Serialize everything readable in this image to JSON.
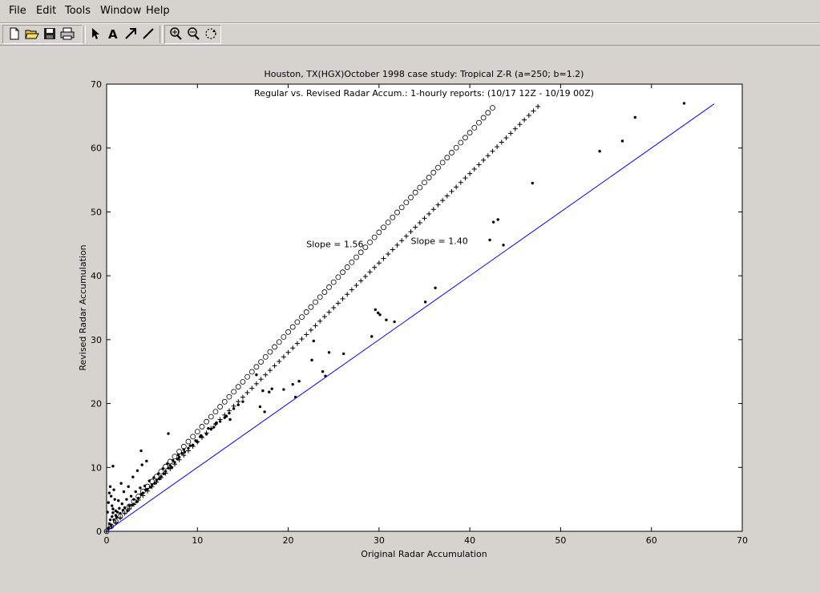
{
  "menu": {
    "file": "File",
    "edit": "Edit",
    "tools": "Tools",
    "window": "Window",
    "help": "Help"
  },
  "toolbar": {
    "icons": [
      "new-file-icon",
      "open-folder-icon",
      "save-icon",
      "print-icon",
      "arrow-select-icon",
      "text-icon",
      "draw-arrow-icon",
      "draw-line-icon",
      "zoom-in-icon",
      "zoom-out-icon",
      "rotate-icon"
    ]
  },
  "chart_data": {
    "type": "scatter",
    "title": "Houston, TX(HGX)October 1998 case study: Tropical Z-R (a=250; b=1.2)",
    "subtitle": "Regular vs. Revised Radar Accum.: 1-hourly reports: (10/17 12Z - 10/19 00Z)",
    "xlabel": "Original Radar Accumulation",
    "ylabel": "Revised Radar Accumulation",
    "xlim": [
      0,
      70
    ],
    "ylim": [
      0,
      70
    ],
    "xticks": [
      0,
      10,
      20,
      30,
      40,
      50,
      60,
      70
    ],
    "yticks": [
      0,
      10,
      20,
      30,
      40,
      50,
      60,
      70
    ],
    "grid": false,
    "annotations": [
      {
        "text": "Slope = 1.56",
        "x": 22.0,
        "y": 44.5
      },
      {
        "text": "Slope = 1.40",
        "x": 33.5,
        "y": 45.0
      }
    ],
    "series": [
      {
        "marker": "dot",
        "x": [
          0.2,
          0.3,
          0.5,
          0.6,
          0.8,
          1.0,
          1.2,
          1.5,
          1.8,
          2.0,
          2.3,
          2.5,
          2.8,
          3.0,
          3.3,
          3.5,
          3.8,
          4.0,
          4.3,
          4.5,
          4.8,
          5.0,
          5.3,
          5.5,
          5.8,
          6.0,
          6.3,
          6.5,
          6.8,
          7.0,
          7.2,
          7.5,
          7.8,
          8.0,
          8.3,
          8.6,
          9.0,
          9.5,
          10.0,
          10.5,
          11.0,
          11.5,
          12.0,
          12.5,
          13.0,
          13.5,
          14.0,
          14.5,
          15.0,
          0.4,
          0.7,
          1.1,
          1.4,
          1.7,
          2.2,
          2.7,
          3.2,
          3.7,
          4.2,
          4.7,
          5.2,
          5.7,
          6.2,
          6.7,
          7.3,
          7.9,
          8.5,
          9.2,
          9.8,
          10.4,
          11.2,
          12.1,
          13.2,
          0.1,
          0.2,
          0.3,
          0.4,
          0.5,
          0.6,
          0.7,
          0.8,
          0.9,
          1.0,
          1.3,
          1.6,
          1.9,
          2.4,
          2.9,
          3.4,
          3.9,
          4.4,
          0.7,
          3.8,
          6.8,
          10.3,
          11.8,
          13.6,
          16.9,
          17.4,
          18.2,
          17.9,
          16.5,
          17.2,
          19.5,
          20.5,
          20.8,
          21.2,
          22.8,
          22.6,
          24.1,
          24.5,
          23.8,
          26.1,
          29.2,
          29.6,
          29.9,
          30.1,
          30.8,
          31.7,
          35.1,
          36.2,
          42.2,
          42.6,
          43.1,
          43.7,
          46.9,
          54.3,
          56.8,
          58.2,
          63.6
        ],
        "y": [
          0.5,
          1.2,
          1.0,
          2.3,
          1.8,
          2.5,
          3.0,
          2.8,
          3.3,
          3.7,
          3.2,
          4.0,
          4.1,
          5.0,
          4.6,
          5.2,
          5.8,
          6.0,
          6.5,
          6.6,
          6.9,
          7.3,
          7.5,
          8.0,
          8.2,
          8.6,
          9.0,
          9.4,
          9.9,
          10.3,
          10.0,
          10.8,
          11.3,
          11.6,
          12.2,
          12.4,
          13.0,
          13.5,
          14.0,
          14.8,
          15.2,
          16.0,
          16.8,
          17.2,
          17.8,
          18.5,
          19.2,
          19.8,
          20.3,
          1.8,
          2.9,
          2.2,
          3.6,
          4.3,
          5.0,
          5.5,
          6.2,
          6.8,
          7.1,
          7.9,
          8.4,
          9.0,
          9.8,
          10.6,
          11.1,
          12.0,
          12.8,
          13.4,
          14.2,
          15.0,
          16.1,
          17.0,
          18.0,
          3.0,
          4.5,
          6.0,
          7.0,
          5.5,
          4.0,
          3.5,
          6.5,
          5.0,
          3.2,
          4.8,
          7.5,
          6.2,
          7.0,
          8.5,
          9.5,
          10.4,
          11.0,
          10.2,
          12.6,
          15.3,
          14.8,
          16.3,
          17.5,
          19.5,
          18.7,
          22.3,
          21.8,
          24.5,
          22.0,
          22.2,
          23.0,
          21.0,
          23.5,
          29.8,
          26.8,
          24.3,
          28.0,
          25.0,
          27.8,
          30.5,
          34.7,
          34.2,
          33.9,
          33.1,
          32.8,
          35.9,
          38.1,
          45.6,
          48.4,
          48.8,
          44.8,
          54.5,
          59.5,
          61.1,
          64.8,
          67.0
        ]
      },
      {
        "marker": "circle",
        "slope": 1.56,
        "x": [
          0.0,
          0.5,
          1.0,
          1.5,
          2.0,
          2.5,
          3.0,
          3.5,
          4.0,
          4.5,
          5.0,
          5.5,
          6.0,
          6.5,
          7.0,
          7.5,
          8.0,
          8.5,
          9.0,
          9.5,
          10.0,
          10.5,
          11.0,
          11.5,
          12.0,
          12.5,
          13.0,
          13.5,
          14.0,
          14.5,
          15.0,
          15.5,
          16.0,
          16.5,
          17.0,
          17.5,
          18.0,
          18.5,
          19.0,
          19.5,
          20.0,
          20.5,
          21.0,
          21.5,
          22.0,
          22.5,
          23.0,
          23.5,
          24.0,
          24.5,
          25.0,
          25.5,
          26.0,
          26.5,
          27.0,
          27.5,
          28.0,
          28.5,
          29.0,
          29.5,
          30.0,
          30.5,
          31.0,
          31.5,
          32.0,
          32.5,
          33.0,
          33.5,
          34.0,
          34.5,
          35.0,
          35.5,
          36.0,
          36.5,
          37.0,
          37.5,
          38.0,
          38.5,
          39.0,
          39.5,
          40.0,
          40.5,
          41.0,
          41.5,
          42.0,
          42.5
        ]
      },
      {
        "marker": "plus",
        "slope": 1.4,
        "x": [
          0.0,
          0.5,
          1.0,
          1.5,
          2.0,
          2.5,
          3.0,
          3.5,
          4.0,
          4.5,
          5.0,
          5.5,
          6.0,
          6.5,
          7.0,
          7.5,
          8.0,
          8.5,
          9.0,
          9.5,
          10.0,
          10.5,
          11.0,
          11.5,
          12.0,
          12.5,
          13.0,
          13.5,
          14.0,
          14.5,
          15.0,
          15.5,
          16.0,
          16.5,
          17.0,
          17.5,
          18.0,
          18.5,
          19.0,
          19.5,
          20.0,
          20.5,
          21.0,
          21.5,
          22.0,
          22.5,
          23.0,
          23.5,
          24.0,
          24.5,
          25.0,
          25.5,
          26.0,
          26.5,
          27.0,
          27.5,
          28.0,
          28.5,
          29.0,
          29.5,
          30.0,
          30.5,
          31.0,
          31.5,
          32.0,
          32.5,
          33.0,
          33.5,
          34.0,
          34.5,
          35.0,
          35.5,
          36.0,
          36.5,
          37.0,
          37.5,
          38.0,
          38.5,
          39.0,
          39.5,
          40.0,
          40.5,
          41.0,
          41.5,
          42.0,
          42.5,
          43.0,
          43.5,
          44.0,
          44.5,
          45.0,
          45.5,
          46.0,
          46.5,
          47.0,
          47.5
        ]
      },
      {
        "marker": "line",
        "color": "#0000ff",
        "x": [
          0,
          66.9
        ],
        "y": [
          0,
          66.9
        ]
      }
    ]
  }
}
